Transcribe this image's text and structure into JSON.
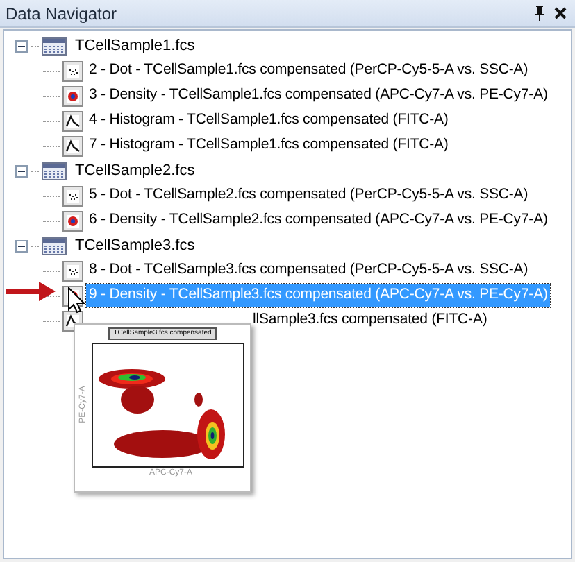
{
  "panel": {
    "title": "Data Navigator"
  },
  "tree": [
    {
      "label": "TCellSample1.fcs",
      "expanded": true,
      "children": [
        {
          "kind": "dot",
          "label": "2 - Dot - TCellSample1.fcs compensated (PerCP-Cy5-5-A vs. SSC-A)",
          "selected": false
        },
        {
          "kind": "density",
          "label": "3 - Density - TCellSample1.fcs compensated (APC-Cy7-A vs. PE-Cy7-A)",
          "selected": false
        },
        {
          "kind": "histogram",
          "label": "4 - Histogram - TCellSample1.fcs compensated (FITC-A)",
          "selected": false
        },
        {
          "kind": "histogram",
          "label": "7 - Histogram - TCellSample1.fcs compensated (FITC-A)",
          "selected": false
        }
      ]
    },
    {
      "label": "TCellSample2.fcs",
      "expanded": true,
      "children": [
        {
          "kind": "dot",
          "label": "5 - Dot - TCellSample2.fcs compensated (PerCP-Cy5-5-A vs. SSC-A)",
          "selected": false
        },
        {
          "kind": "density",
          "label": "6 - Density - TCellSample2.fcs compensated (APC-Cy7-A vs. PE-Cy7-A)",
          "selected": false
        }
      ]
    },
    {
      "label": "TCellSample3.fcs",
      "expanded": true,
      "children": [
        {
          "kind": "dot",
          "label": "8 - Dot - TCellSample3.fcs compensated (PerCP-Cy5-5-A vs. SSC-A)",
          "selected": false
        },
        {
          "kind": "density",
          "label": "9 - Density - TCellSample3.fcs compensated (APC-Cy7-A vs. PE-Cy7-A)",
          "selected": true
        },
        {
          "kind": "histogram",
          "label": "llSample3.fcs compensated (FITC-A)",
          "selected": false,
          "covered": true
        }
      ]
    }
  ],
  "preview": {
    "title": "TCellSample3.fcs compensated",
    "ylabel": "PE-Cy7-A",
    "xlabel": "APC-Cy7-A"
  }
}
